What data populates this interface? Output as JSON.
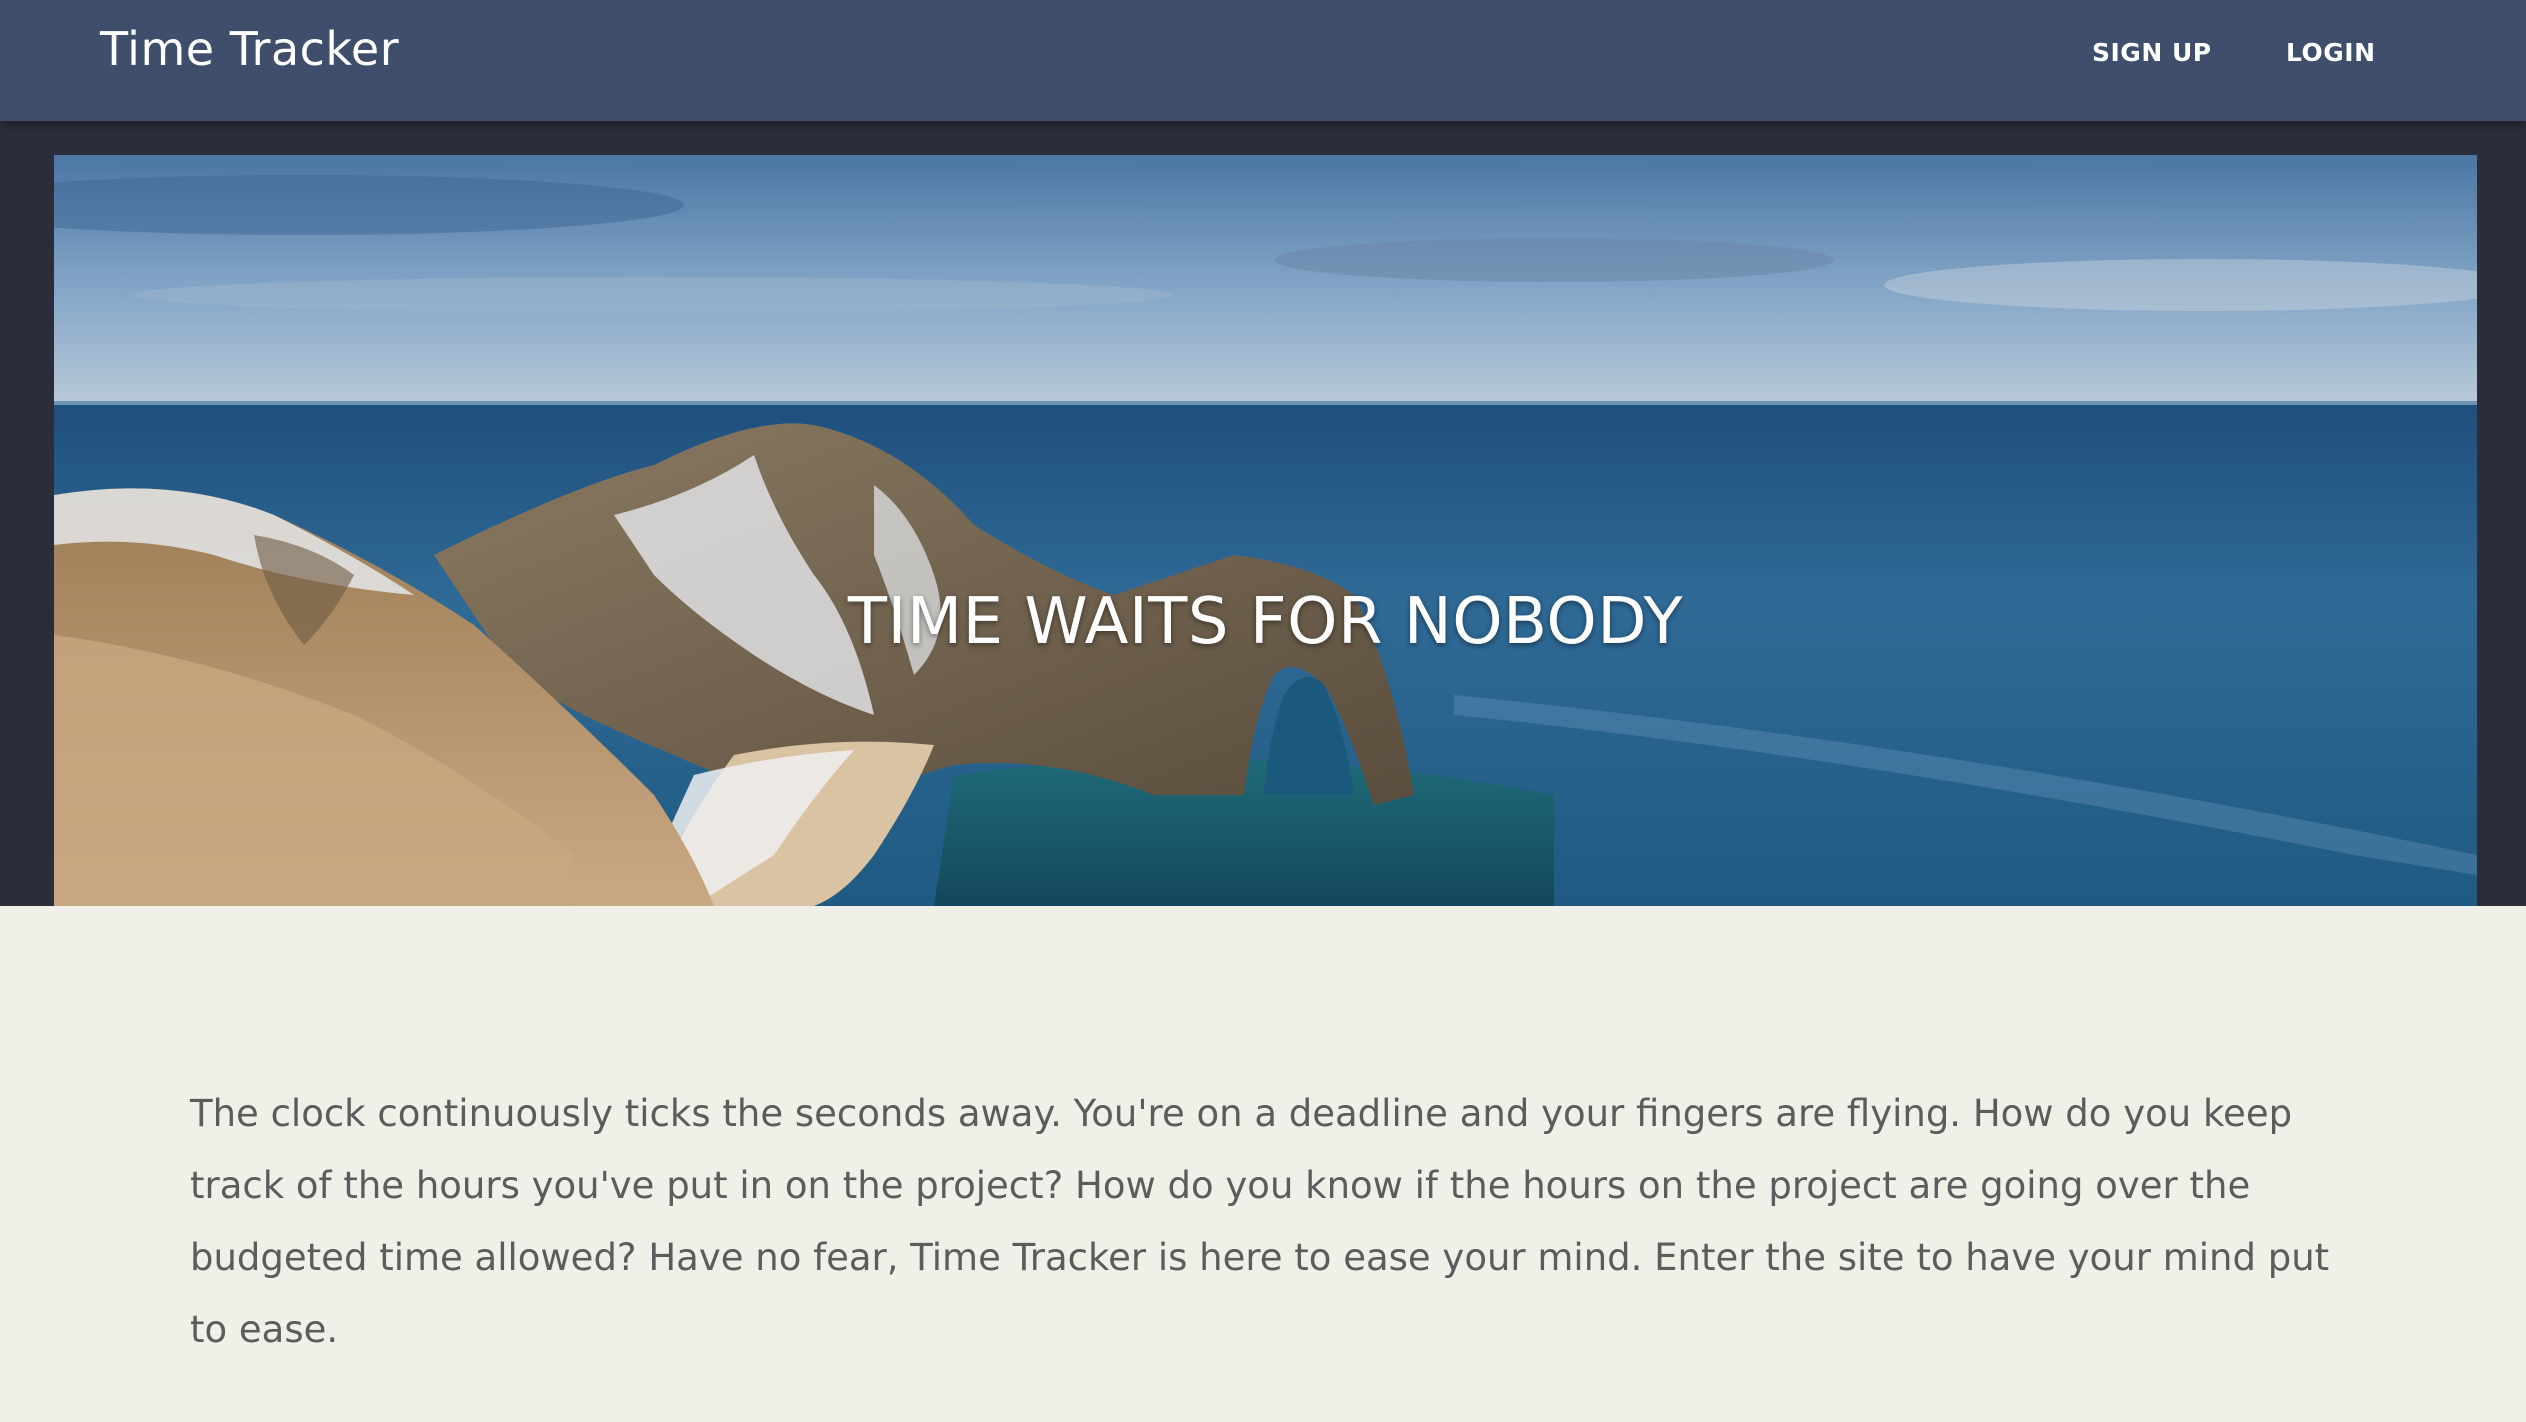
{
  "navbar": {
    "brand": "Time Tracker",
    "links": [
      {
        "label": "SIGN UP"
      },
      {
        "label": "LOGIN"
      }
    ]
  },
  "hero": {
    "title": "TIME WAITS FOR NOBODY",
    "image": "coastal-rock-arch-landscape"
  },
  "content": {
    "paragraph": "The clock continuously ticks the seconds away. You're on a deadline and your fingers are flying. How do you keep track of the hours you've put in on the project? How do you know if the hours on the project are going over the budgeted time allowed? Have no fear, Time Tracker is here to ease your mind. Enter the site to have your mind put to ease."
  },
  "colors": {
    "navbar": "#3f4f6b",
    "hero_band": "#2b2d3b",
    "page_background": "#f0f0e9",
    "body_text": "#5c5c5c"
  }
}
